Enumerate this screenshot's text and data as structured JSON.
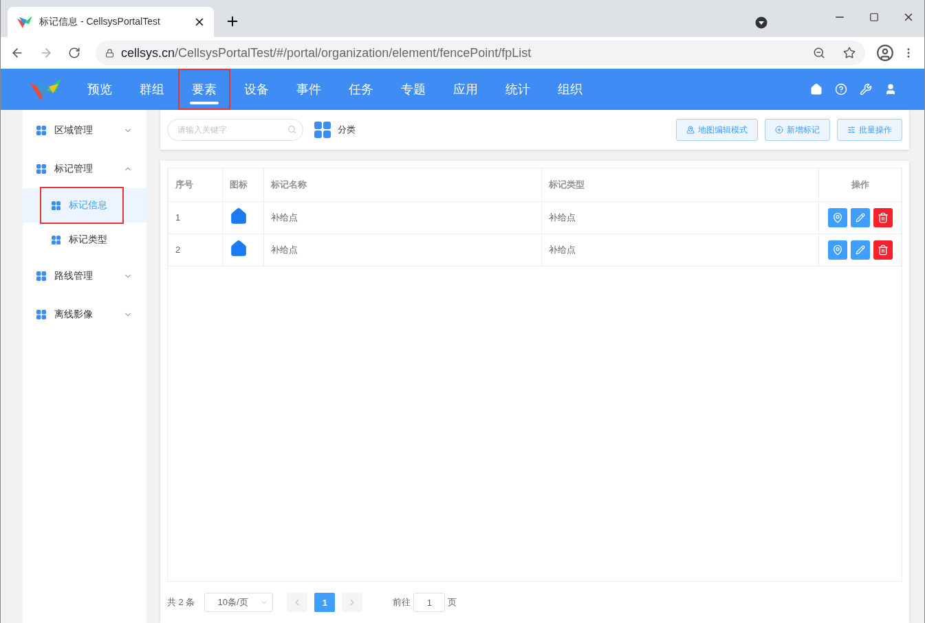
{
  "browser": {
    "tab_title": "标记信息 - CellsysPortalTest",
    "url_host": "cellsys.cn",
    "url_path": "/CellsysPortalTest/#/portal/organization/element/fencePoint/fpList"
  },
  "nav": {
    "items": [
      {
        "label": "预览",
        "selected": false,
        "highlighted": false
      },
      {
        "label": "群组",
        "selected": false,
        "highlighted": false
      },
      {
        "label": "要素",
        "selected": true,
        "highlighted": true
      },
      {
        "label": "设备",
        "selected": false,
        "highlighted": false
      },
      {
        "label": "事件",
        "selected": false,
        "highlighted": false
      },
      {
        "label": "任务",
        "selected": false,
        "highlighted": false
      },
      {
        "label": "专题",
        "selected": false,
        "highlighted": false
      },
      {
        "label": "应用",
        "selected": false,
        "highlighted": false
      },
      {
        "label": "统计",
        "selected": false,
        "highlighted": false
      },
      {
        "label": "组织",
        "selected": false,
        "highlighted": false
      }
    ]
  },
  "sidebar": {
    "items": [
      {
        "label": "区域管理",
        "expanded": false
      },
      {
        "label": "标记管理",
        "expanded": true,
        "children": [
          {
            "label": "标记信息",
            "selected": true,
            "highlighted": true
          },
          {
            "label": "标记类型",
            "selected": false,
            "highlighted": false
          }
        ]
      },
      {
        "label": "路线管理",
        "expanded": false
      },
      {
        "label": "离线影像",
        "expanded": false
      }
    ]
  },
  "toolbar": {
    "search": {
      "placeholder": "请输入关键字"
    },
    "category_label": "分类",
    "buttons": [
      {
        "kind": "map",
        "label": "地图编辑模式"
      },
      {
        "kind": "add",
        "label": "新增标记"
      },
      {
        "kind": "batch",
        "label": "批量操作"
      }
    ]
  },
  "table": {
    "columns": [
      "序号",
      "图标",
      "标记名称",
      "标记类型",
      "操作"
    ],
    "rows": [
      {
        "index": "1",
        "name": "补给点",
        "type": "补给点"
      },
      {
        "index": "2",
        "name": "补给点",
        "type": "补给点"
      }
    ]
  },
  "pagination": {
    "total": "共 2 条",
    "page_size": "10条/页",
    "pages": [
      {
        "label": "1",
        "selected": true
      }
    ],
    "goto_label": "前往",
    "goto_value": "1",
    "page_unit": "页"
  }
}
